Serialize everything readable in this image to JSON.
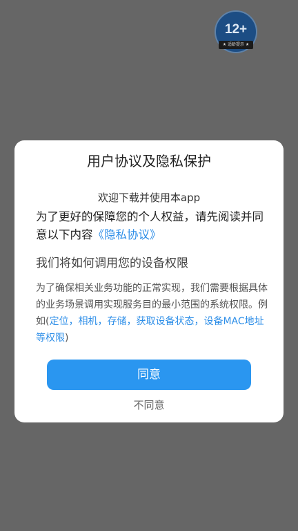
{
  "age_badge": {
    "rating": "12+",
    "caption": "★ 适龄提示 ★"
  },
  "dialog": {
    "title": "用户协议及隐私保护",
    "welcome": "欢迎下载并使用本app",
    "intro_text": "为了更好的保障您的个人权益，请先阅读并同意以下内容",
    "privacy_link": "《隐私协议》",
    "permissions_heading": "我们将如何调用您的设备权限",
    "permissions_desc": "为了确保相关业务功能的正常实现，我们需要根据具体的业务场景调用实现服务目的最小范围的系统权限。例如(",
    "permissions_examples": "定位，相机，存储，获取设备状态，设备MAC地址等权限",
    "permissions_desc_end": ")",
    "agree_label": "同意",
    "disagree_label": "不同意"
  },
  "colors": {
    "overlay": "#666666",
    "accent": "#2a96f0",
    "link": "#2f8fe8"
  }
}
